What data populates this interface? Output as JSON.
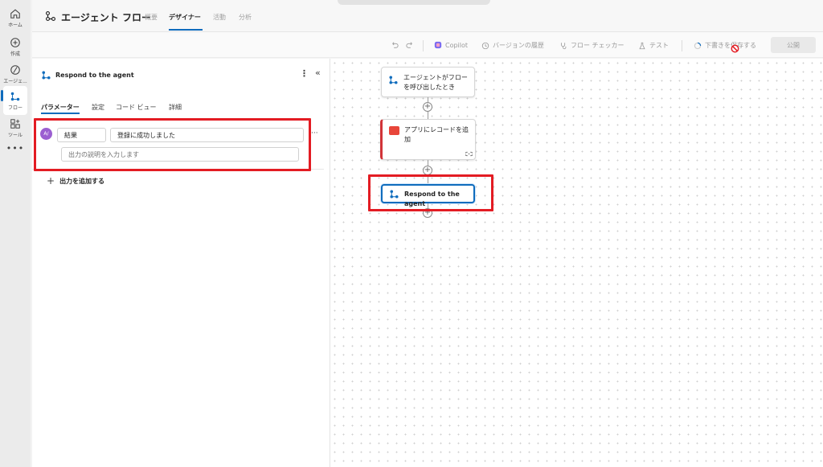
{
  "rail": {
    "items": [
      {
        "label": "ホーム",
        "icon": "home-icon"
      },
      {
        "label": "作成",
        "icon": "plus-circle-icon"
      },
      {
        "label": "エージェ...",
        "icon": "agent-icon"
      },
      {
        "label": "フロー",
        "icon": "flow-icon"
      },
      {
        "label": "ツール",
        "icon": "tools-icon"
      }
    ],
    "more": "•••"
  },
  "header": {
    "title": "エージェント フロー",
    "tabs": [
      "概要",
      "デザイナー",
      "活動",
      "分析"
    ],
    "active_tab": "デザイナー"
  },
  "toolbar": {
    "copilot": "Copilot",
    "version_history": "バージョンの履歴",
    "flow_checker": "フロー チェッカー",
    "test": "テスト",
    "save_draft": "下書きを保存する",
    "publish": "公開"
  },
  "panel": {
    "title": "Respond to the agent",
    "tabs": [
      "パラメーター",
      "設定",
      "コード ビュー",
      "詳細"
    ],
    "active_tab": "パラメーター",
    "param": {
      "name": "結果",
      "value": "登録に成功しました",
      "description_placeholder": "出力の説明を入力します",
      "avatar_text": "A/"
    },
    "add_output": "出力を追加する"
  },
  "canvas": {
    "nodes": [
      {
        "label_line1": "エージェントがフロー",
        "label_line2": "を呼び出したとき",
        "icon": "flow-trigger-icon"
      },
      {
        "label_line1": "アプリにレコードを追",
        "label_line2": "加",
        "icon": "dataverse-icon"
      },
      {
        "label_line1": "Respond to the agent",
        "label_line2": "",
        "icon": "flow-respond-icon"
      }
    ]
  },
  "colors": {
    "accent": "#0f6cbd",
    "highlight": "#e31c23",
    "error": "#d13438",
    "avatar": "#9b5fd1"
  }
}
